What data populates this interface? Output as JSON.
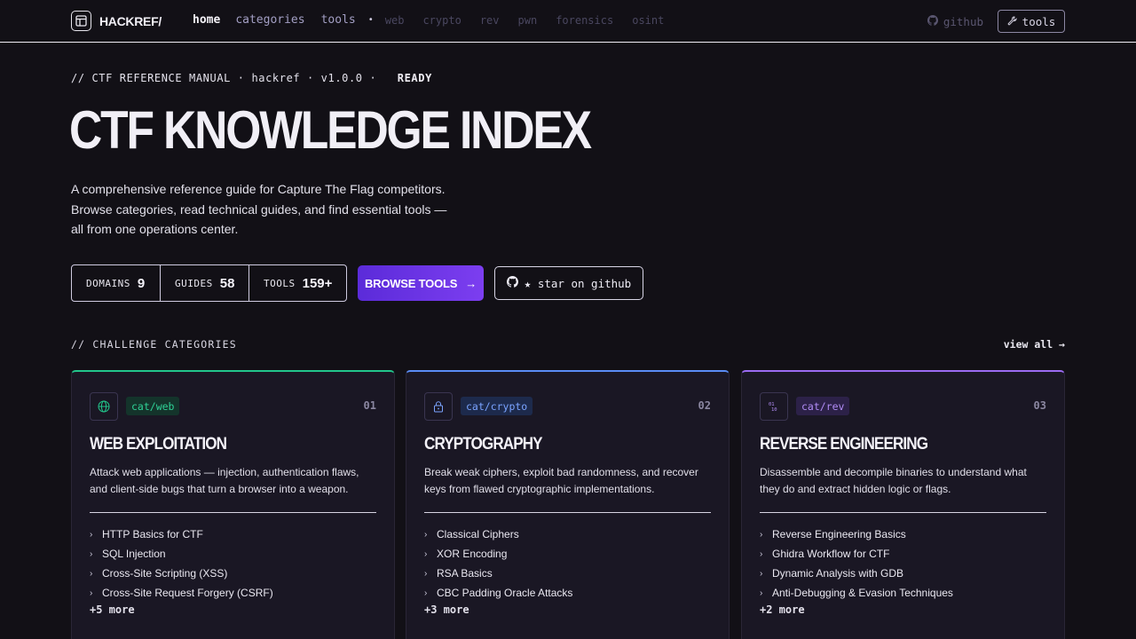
{
  "nav": {
    "logo": "HACKREF/",
    "links": [
      "home",
      "categories",
      "tools"
    ],
    "separator": "•",
    "sub_links": [
      "web",
      "crypto",
      "rev",
      "pwn",
      "forensics",
      "osint"
    ],
    "github": "github",
    "tools_btn": "tools"
  },
  "hero": {
    "kicker": "// CTF REFERENCE MANUAL · hackref · v1.0.0 ·",
    "status": "READY",
    "title": "CTF KNOWLEDGE INDEX",
    "description": "A comprehensive reference guide for Capture The Flag competitors. Browse categories, read technical guides, and find essential tools — all from one operations center.",
    "stats": [
      {
        "label": "DOMAINS",
        "value": "9"
      },
      {
        "label": "GUIDES",
        "value": "58"
      },
      {
        "label": "TOOLS",
        "value": "159+"
      }
    ],
    "browse_btn": "BROWSE TOOLS",
    "browse_arrow": "→",
    "star_btn": "★ star on github"
  },
  "categories": {
    "section_title": "// CHALLENGE CATEGORIES",
    "view_all": "view all →",
    "cards": [
      {
        "tag": "cat/web",
        "number": "01",
        "title": "WEB EXPLOITATION",
        "description": "Attack web applications — injection, authentication flaws, and client-side bugs that turn a browser into a weapon.",
        "guides": [
          "HTTP Basics for CTF",
          "SQL Injection",
          "Cross-Site Scripting (XSS)",
          "Cross-Site Request Forgery (CSRF)"
        ],
        "more": "+5 more",
        "accent": "#22c58b",
        "icon": "globe-icon"
      },
      {
        "tag": "cat/crypto",
        "number": "02",
        "title": "CRYPTOGRAPHY",
        "description": "Break weak ciphers, exploit bad randomness, and recover keys from flawed cryptographic implementations.",
        "guides": [
          "Classical Ciphers",
          "XOR Encoding",
          "RSA Basics",
          "CBC Padding Oracle Attacks"
        ],
        "more": "+3 more",
        "accent": "#5a8cf5",
        "icon": "lock-icon"
      },
      {
        "tag": "cat/rev",
        "number": "03",
        "title": "REVERSE ENGINEERING",
        "description": "Disassemble and decompile binaries to understand what they do and extract hidden logic or flags.",
        "guides": [
          "Reverse Engineering Basics",
          "Ghidra Workflow for CTF",
          "Dynamic Analysis with GDB",
          "Anti-Debugging & Evasion Techniques"
        ],
        "more": "+2 more",
        "accent": "#9b6bf2",
        "icon": "binary-icon"
      }
    ]
  }
}
